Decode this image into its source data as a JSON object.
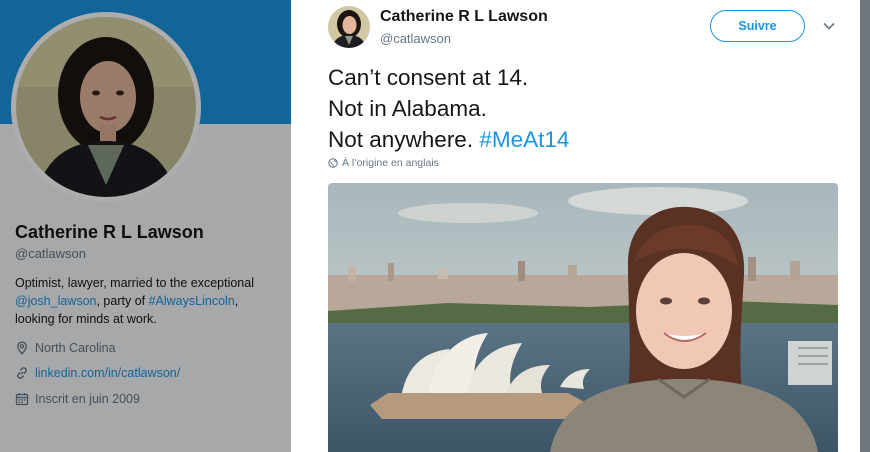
{
  "profile": {
    "name": "Catherine R L Lawson",
    "handle": "@catlawson",
    "bio": {
      "line1": "Optimist, lawyer, married to the exceptional",
      "mention": "@josh_lawson",
      "middle": ", party of ",
      "hashtag": "#AlwaysLincoln",
      "end": ",",
      "line3": "looking for minds at work."
    },
    "location": "North Carolina",
    "website": "linkedin.com/in/catlawson/",
    "joined": "Inscrit en juin 2009",
    "icons": {
      "location": "location-pin-icon",
      "website": "link-icon",
      "joined": "calendar-icon"
    }
  },
  "tweet": {
    "author_name": "Catherine R L Lawson",
    "author_handle": "@catlawson",
    "follow_label": "Suivre",
    "menu_icon": "chevron-down-icon",
    "text_lines": [
      "Can’t consent at 14.",
      "Not in Alabama.",
      "Not anywhere. "
    ],
    "hashtag": "#MeAt14",
    "translation_note": "À l’origine en anglais",
    "translation_icon": "globe-icon"
  },
  "colors": {
    "accent": "#1b95e0",
    "text": "#14171a",
    "secondary_text": "#657786",
    "overlay_bg": "#6e767d"
  }
}
